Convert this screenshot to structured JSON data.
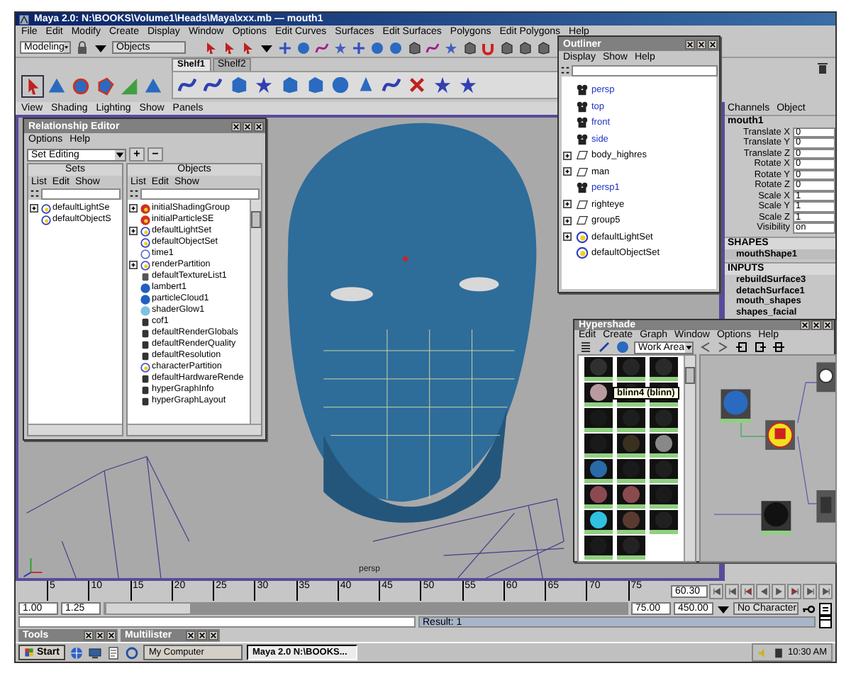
{
  "window": {
    "title": "Maya 2.0: N:\\BOOKS\\Volume1\\Heads\\Maya\\xxx.mb  —  mouth1"
  },
  "menu": [
    "File",
    "Edit",
    "Modify",
    "Create",
    "Display",
    "Window",
    "Options",
    "Edit Curves",
    "Surfaces",
    "Edit Surfaces",
    "Polygons",
    "Edit Polygons",
    "Help"
  ],
  "status_line": {
    "mode": "Modeling",
    "selection_mode": "Objects"
  },
  "shelf_tabs": [
    {
      "label": "Shelf1",
      "selected": true
    },
    {
      "label": "Shelf2",
      "selected": false
    }
  ],
  "viewport": {
    "menu": [
      "View",
      "Shading",
      "Lighting",
      "Show",
      "Panels"
    ],
    "camera": "persp"
  },
  "channel_box": {
    "menu": [
      "Channels",
      "Object"
    ],
    "node": "mouth1",
    "attributes": [
      {
        "name": "Translate X",
        "value": "0"
      },
      {
        "name": "Translate Y",
        "value": "0"
      },
      {
        "name": "Translate Z",
        "value": "0"
      },
      {
        "name": "Rotate X",
        "value": "0"
      },
      {
        "name": "Rotate Y",
        "value": "0"
      },
      {
        "name": "Rotate Z",
        "value": "0"
      },
      {
        "name": "Scale X",
        "value": "1"
      },
      {
        "name": "Scale Y",
        "value": "1"
      },
      {
        "name": "Scale Z",
        "value": "1"
      },
      {
        "name": "Visibility",
        "value": "on"
      }
    ],
    "shapes_heading": "SHAPES",
    "shapes": [
      "mouthShape1"
    ],
    "inputs_heading": "INPUTS",
    "inputs": [
      "rebuildSurface3",
      "detachSurface1",
      "mouth_shapes",
      "shapes_facial"
    ]
  },
  "relationship_editor": {
    "title": "Relationship Editor",
    "menu": [
      "Options",
      "Help"
    ],
    "mode": "Set Editing",
    "buttons": [
      "+",
      "−"
    ],
    "sets": {
      "title": "Sets",
      "menu": [
        "List",
        "Edit",
        "Show"
      ],
      "items": [
        {
          "name": "defaultLightSe",
          "kind": "set",
          "expandable": true
        },
        {
          "name": "defaultObjectS",
          "kind": "set",
          "expandable": false
        }
      ]
    },
    "objects": {
      "title": "Objects",
      "menu": [
        "List",
        "Edit",
        "Show"
      ],
      "items": [
        {
          "name": "initialShadingGroup",
          "kind": "shader",
          "expandable": true
        },
        {
          "name": "initialParticleSE",
          "kind": "shader",
          "expandable": false
        },
        {
          "name": "defaultLightSet",
          "kind": "set",
          "expandable": true
        },
        {
          "name": "defaultObjectSet",
          "kind": "set",
          "expandable": false
        },
        {
          "name": "time1",
          "kind": "time",
          "expandable": false
        },
        {
          "name": "renderPartition",
          "kind": "partition",
          "expandable": true
        },
        {
          "name": "defaultTextureList1",
          "kind": "list",
          "expandable": false
        },
        {
          "name": "lambert1",
          "kind": "material",
          "expandable": false
        },
        {
          "name": "particleCloud1",
          "kind": "material",
          "expandable": false
        },
        {
          "name": "shaderGlow1",
          "kind": "glow",
          "expandable": false
        },
        {
          "name": "cof1",
          "kind": "node",
          "expandable": false
        },
        {
          "name": "defaultRenderGlobals",
          "kind": "node",
          "expandable": false
        },
        {
          "name": "defaultRenderQuality",
          "kind": "node",
          "expandable": false
        },
        {
          "name": "defaultResolution",
          "kind": "node",
          "expandable": false
        },
        {
          "name": "characterPartition",
          "kind": "partition",
          "expandable": false
        },
        {
          "name": "defaultHardwareRende",
          "kind": "node",
          "expandable": false
        },
        {
          "name": "hyperGraphInfo",
          "kind": "node",
          "expandable": false
        },
        {
          "name": "hyperGraphLayout",
          "kind": "node",
          "expandable": false
        }
      ]
    }
  },
  "outliner": {
    "title": "Outliner",
    "menu": [
      "Display",
      "Show",
      "Help"
    ],
    "items": [
      {
        "name": "persp",
        "kind": "camera",
        "expandable": false
      },
      {
        "name": "top",
        "kind": "camera",
        "expandable": false
      },
      {
        "name": "front",
        "kind": "camera",
        "expandable": false
      },
      {
        "name": "side",
        "kind": "camera",
        "expandable": false
      },
      {
        "name": "body_highres",
        "kind": "transform",
        "expandable": true
      },
      {
        "name": "man",
        "kind": "transform",
        "expandable": true
      },
      {
        "name": "persp1",
        "kind": "camera",
        "expandable": false
      },
      {
        "name": "righteye",
        "kind": "transform",
        "expandable": true
      },
      {
        "name": "group5",
        "kind": "transform",
        "expandable": true
      },
      {
        "name": "defaultLightSet",
        "kind": "set",
        "expandable": true
      },
      {
        "name": "defaultObjectSet",
        "kind": "set",
        "expandable": false
      }
    ]
  },
  "hypershade": {
    "title": "Hypershade",
    "menu": [
      "Edit",
      "Create",
      "Graph",
      "Window",
      "Options",
      "Help"
    ],
    "tab": "Work Area",
    "tooltip": "blinn4 (blinn)"
  },
  "time_slider": {
    "ticks": [
      "5",
      "10",
      "15",
      "20",
      "25",
      "30",
      "35",
      "40",
      "45",
      "50",
      "55",
      "60",
      "65",
      "70",
      "75"
    ],
    "current_time": "60.30"
  },
  "range_slider": {
    "level": 0.16,
    "start": "1.00",
    "range_start": "1.25",
    "range_end": "75.00",
    "end": "450.00",
    "character": "No Character"
  },
  "command_line": {
    "result": "Result: 1"
  },
  "minimized_windows": [
    {
      "title": "Tools"
    },
    {
      "title": "Multilister"
    }
  ],
  "taskbar": {
    "start": "Start",
    "buttons": [
      {
        "label": "My Computer",
        "selected": false
      },
      {
        "label": "Maya 2.0  N:\\BOOKS...",
        "selected": true
      }
    ],
    "clock": "10:30 AM"
  }
}
